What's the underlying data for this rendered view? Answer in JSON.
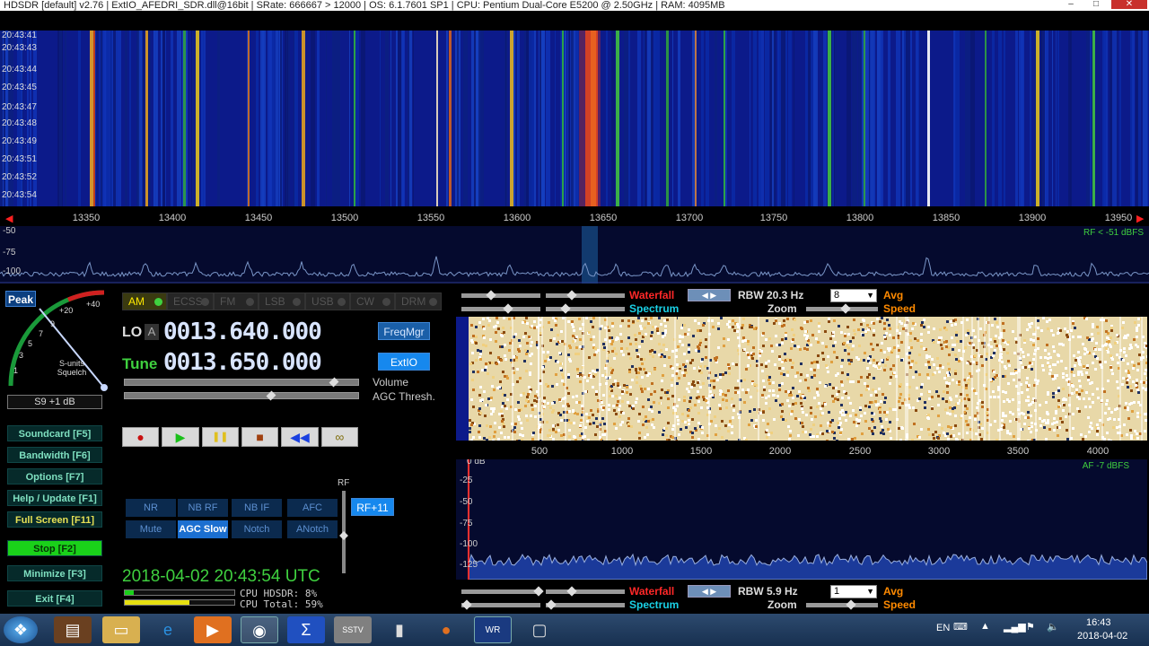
{
  "titlebar": {
    "text": "HDSDR  [default]  v2.76    |    ExtIO_AFEDRI_SDR.dll@16bit    |    SRate: 666667 > 12000    |    OS: 6.1.7601 SP1    |    CPU: Pentium Dual-Core        E5200  @ 2.50GHz    |    RAM: 4095MB",
    "minimize": "–",
    "maximize": "□",
    "close": "✕"
  },
  "waterfall": {
    "timestamps": [
      "20:43:41",
      "20:43:43",
      "20:43:44",
      "20:43:45",
      "20:43:47",
      "20:43:48",
      "20:43:49",
      "20:43:51",
      "20:43:52",
      "20:43:54"
    ]
  },
  "freq_axis": {
    "ticks": [
      "13350",
      "13400",
      "13450",
      "13500",
      "13550",
      "13600",
      "13650",
      "13700",
      "13750",
      "13800",
      "13850",
      "13900",
      "13950"
    ]
  },
  "spectrum": {
    "levels": [
      "-50",
      "-75",
      "-100"
    ],
    "rf_label": "RF < -51 dBFS"
  },
  "smeter": {
    "peak": "Peak",
    "scale": [
      "+20",
      "+40",
      "9",
      "7",
      "5",
      "3",
      "1"
    ],
    "caption": "S-units Squelch",
    "reading": "S9 +1 dB"
  },
  "modes": [
    {
      "label": "AM",
      "active": true
    },
    {
      "label": "ECSS",
      "active": false
    },
    {
      "label": "FM",
      "active": false
    },
    {
      "label": "LSB",
      "active": false
    },
    {
      "label": "USB",
      "active": false
    },
    {
      "label": "CW",
      "active": false
    },
    {
      "label": "DRM",
      "active": false
    }
  ],
  "lo": {
    "label": "LO",
    "sub": "A",
    "value": "0013.640.000"
  },
  "tune": {
    "label": "Tune",
    "value": "0013.650.000"
  },
  "buttons": {
    "freqmgr": "FreqMgr",
    "extio": "ExtIO",
    "volume": "Volume",
    "agc_thresh": "AGC Thresh.",
    "rf": "RF",
    "rf_gain": "RF+11"
  },
  "transport": [
    "●",
    "▶",
    "❚❚",
    "■",
    "◀◀",
    "∞"
  ],
  "fkeys": [
    {
      "label": "Soundcard  [F5]"
    },
    {
      "label": "Bandwidth  [F6]"
    },
    {
      "label": "Options  [F7]"
    },
    {
      "label": "Help / Update  [F1]"
    },
    {
      "label": "Full Screen  [F11]"
    },
    {
      "label": "Stop          [F2]"
    },
    {
      "label": "Minimize  [F3]"
    },
    {
      "label": "Exit        [F4]"
    }
  ],
  "dsp": {
    "row1": [
      "NR",
      "NB RF",
      "NB IF",
      "AFC"
    ],
    "row2": [
      "Mute",
      "AGC Slow",
      "Notch",
      "ANotch"
    ]
  },
  "status": {
    "clock": "2018-04-02   20:43:54 UTC",
    "cpu_hdsdr": "CPU HDSDR:  8%",
    "cpu_total": "CPU Total: 59%",
    "cpu_hdsdr_fraction": 0.08,
    "cpu_total_fraction": 0.59
  },
  "rf_controls": {
    "waterfall": "Waterfall",
    "spectrum": "Spectrum",
    "rbw": "RBW 20.3 Hz",
    "rbw_select": "8",
    "zoom": "Zoom",
    "avg": "Avg",
    "speed": "Speed"
  },
  "af_controls": {
    "waterfall": "Waterfall",
    "spectrum": "Spectrum",
    "rbw": "RBW  5.9 Hz",
    "rbw_select": "1",
    "zoom": "Zoom",
    "avg": "Avg",
    "speed": "Speed"
  },
  "audio_axis": {
    "ticks": [
      "500",
      "1000",
      "1500",
      "2000",
      "2500",
      "3000",
      "3500",
      "4000"
    ]
  },
  "audio_spectrum": {
    "levels": [
      "0 dB",
      "-25",
      "-50",
      "-75",
      "-100",
      "-125"
    ],
    "af_label": "AF  -7 dBFS"
  },
  "taskbar": {
    "lang": "EN",
    "time": "16:43",
    "date": "2018-04-02",
    "icons": [
      "start-orb",
      "media-center",
      "explorer",
      "internet-explorer",
      "media-player",
      "chrome",
      "hdsdr-sum",
      "sstv",
      "usb-device",
      "firefox",
      "hdsdr",
      "sticky-app"
    ]
  }
}
